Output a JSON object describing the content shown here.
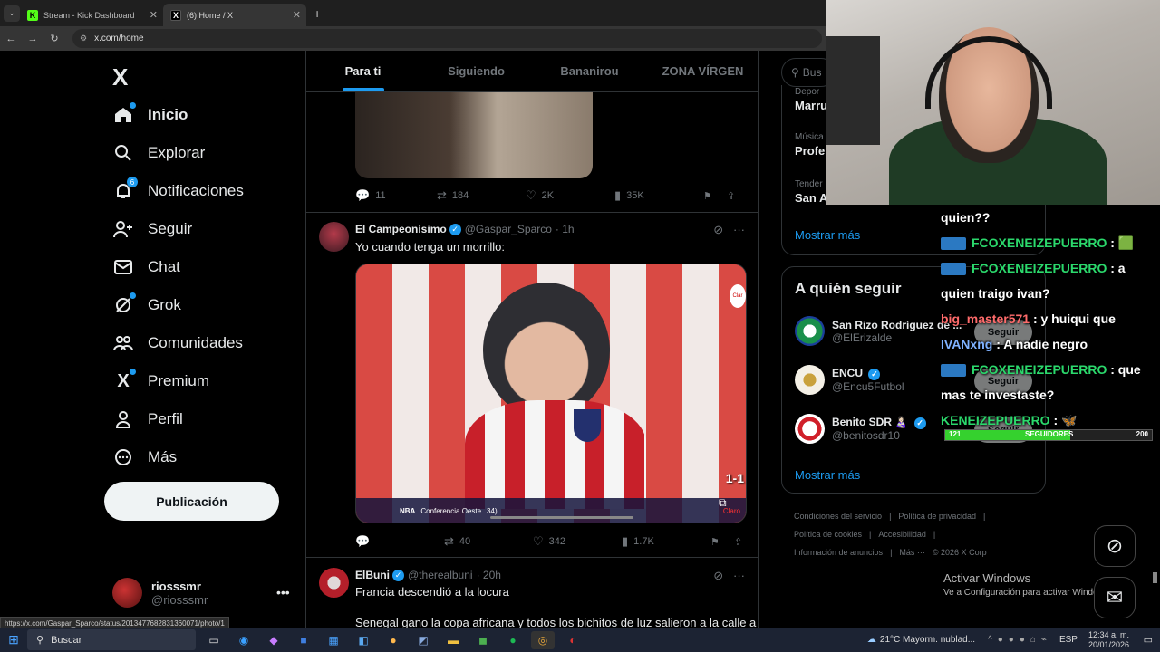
{
  "browser": {
    "tabs": [
      {
        "label": "Stream - Kick Dashboard",
        "active": false
      },
      {
        "label": "(6) Home / X",
        "active": true
      }
    ],
    "url": "x.com/home",
    "status_url": "https://x.com/Gaspar_Sparco/status/2013477682831360071/photo/1"
  },
  "sidebar": {
    "logo": "X",
    "items": [
      {
        "label": "Inicio",
        "icon": "home-icon"
      },
      {
        "label": "Explorar",
        "icon": "search-icon"
      },
      {
        "label": "Notificaciones",
        "icon": "bell-icon",
        "badge": "6"
      },
      {
        "label": "Seguir",
        "icon": "add-person-icon"
      },
      {
        "label": "Chat",
        "icon": "mail-icon"
      },
      {
        "label": "Grok",
        "icon": "grok-icon"
      },
      {
        "label": "Comunidades",
        "icon": "people-icon"
      },
      {
        "label": "Premium",
        "icon": "x-icon"
      },
      {
        "label": "Perfil",
        "icon": "person-icon"
      },
      {
        "label": "Más",
        "icon": "more-circle-icon"
      }
    ],
    "post_button": "Publicación",
    "account": {
      "name": "riosssmr",
      "handle": "@riosssmr"
    }
  },
  "feed": {
    "tabs": [
      "Para ti",
      "Siguiendo",
      "Bananirou",
      "ZONA VÍRGEN"
    ],
    "tweets": [
      {
        "replies": "11",
        "reposts": "184",
        "likes": "2K",
        "views": "35K"
      },
      {
        "name": "El Campeonísimo",
        "handle": "@Gaspar_Sparco",
        "time": "· 1h",
        "text": "Yo cuando tenga un morrillo:",
        "replies": "",
        "reposts": "40",
        "likes": "342",
        "views": "1.7K",
        "media": {
          "score": "1-1",
          "ticker_left": "NBA",
          "ticker_sub": "Conferencia Oeste",
          "ticker_num": "34)",
          "ticker_right": "Claro",
          "corner_logo": "Clar"
        }
      },
      {
        "name": "ElBuni",
        "handle": "@therealbuni",
        "time": "· 20h",
        "text": "Francia descendió a la locura",
        "text2": "Senegal gano la copa africana y todos los bichitos de luz salieron a la calle a"
      }
    ]
  },
  "right": {
    "search_placeholder": "Bus",
    "trends": [
      {
        "category": "Depor",
        "title": "Marru"
      },
      {
        "category": "Música",
        "title": "Profe"
      },
      {
        "category": "Tender",
        "title": "San A"
      }
    ],
    "show_more": "Mostrar más",
    "who_to_follow": {
      "title": "A quién seguir",
      "users": [
        {
          "name": "San Rizo Rodríguez de ...",
          "handle": "@ElErizalde",
          "verified": false
        },
        {
          "name": "ENCU",
          "handle": "@Encu5Futbol",
          "verified": true
        },
        {
          "name": "Benito SDR 👩🏻‍🍼",
          "handle": "@benitosdr10",
          "verified": true
        }
      ],
      "follow_label": "Seguir",
      "show_more": "Mostrar más"
    },
    "footer": [
      "Condiciones del servicio",
      "|",
      "Política de privacidad",
      "|",
      "Política de cookies",
      "|",
      "Accesibilidad",
      "|",
      "Información de anuncios",
      "|",
      "Más ···",
      "© 2026 X Corp"
    ]
  },
  "stream_overlay": {
    "chat": [
      {
        "user": "",
        "text": "quien??"
      },
      {
        "user": "FCOXENEIZEPUERRO",
        "text": " : 🟩"
      },
      {
        "user": "FCOXENEIZEPUERRO",
        "text": " : a"
      },
      {
        "user": "",
        "text": "quien traigo ivan?"
      },
      {
        "user": "big_master571",
        "text": " : y huiqui que"
      },
      {
        "user": "IVANxng",
        "text": " : A nadie negro"
      },
      {
        "user": "FCOXENEIZEPUERRO",
        "text": " : que"
      },
      {
        "user": "",
        "text": "mas te investaste?"
      },
      {
        "user": "KENEIZEPUERRO",
        "text": " : 🦋"
      }
    ],
    "goal": {
      "current": "121",
      "label": "SEGUIDORES",
      "target": "200",
      "progress": 0.605
    }
  },
  "windows": {
    "watermark_title": "Activar Windows",
    "watermark_sub": "Ve a Configuración para activar Windows.",
    "search": "Buscar",
    "weather": "21°C  Mayorm. nublad...",
    "lang": "ESP",
    "time": "12:34 a. m.",
    "date": "20/01/2026"
  }
}
